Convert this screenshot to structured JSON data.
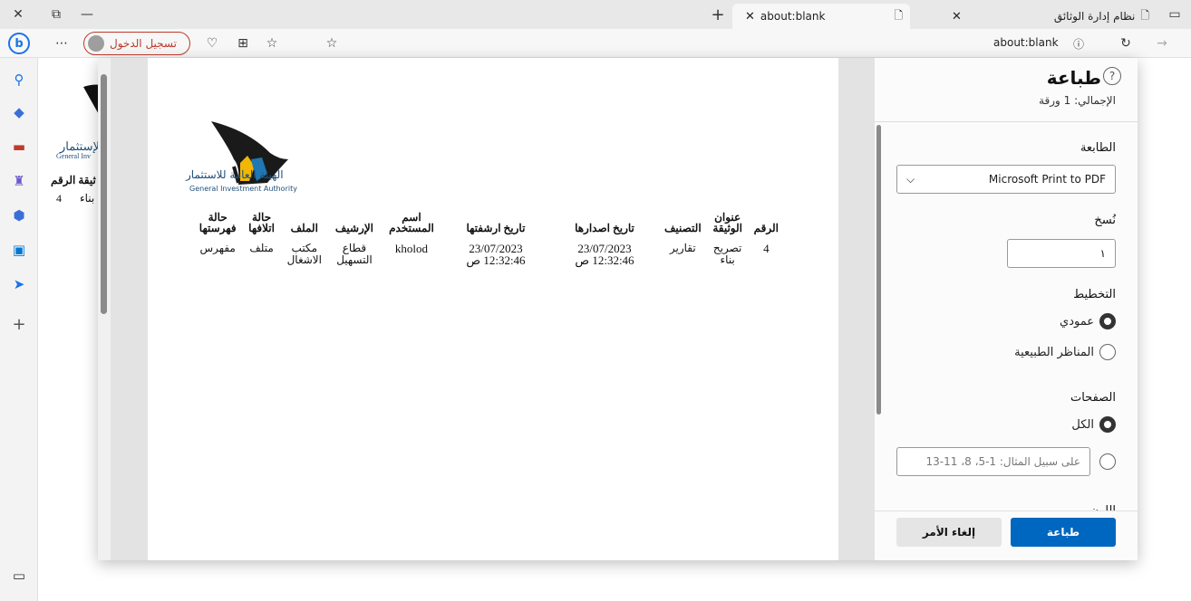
{
  "tabs": [
    {
      "title": "about:blank",
      "active": true
    },
    {
      "title": "نظام إدارة الوثائق",
      "active": false
    }
  ],
  "address": {
    "url": "about:blank",
    "signin_label": "تسجيل الدخول"
  },
  "bg_page": {
    "logo_text": "الإستثمار",
    "logo_en": "General Inv",
    "header": "ثيقة الرقم",
    "row_title": "بناء",
    "row_num": "4"
  },
  "print_panel": {
    "title": "طباعة",
    "total": "الإجمالي: 1 ورقة",
    "printer_label": "الطابعة",
    "printer_value": "Microsoft Print to PDF",
    "copies_label": "نُسخ",
    "copies_value": "١",
    "layout_label": "التخطيط",
    "layout_options": [
      "عمودي",
      "المناظر الطبيعية"
    ],
    "layout_selected": "عمودي",
    "pages_label": "الصفحات",
    "pages_all": "الكل",
    "pages_placeholder": "على سبيل المثال: 1-5، 8، 11-13",
    "color_label": "اللون",
    "print_button": "طباعة",
    "cancel_button": "إلغاء الأمر"
  },
  "document": {
    "logo_ar": "الهيئة العامة للاستثمار",
    "logo_en": "General Investment Authority",
    "columns": [
      "الرقم",
      "عنوان الوثيقة",
      "التصنيف",
      "تاريخ اصدارها",
      "تاريخ ارشفتها",
      "اسم المستخدم",
      "الإرشيف",
      "الملف",
      "حالة اتلافها",
      "حالة فهرستها"
    ],
    "rows": [
      {
        "number": "4",
        "title": "تصريح بناء",
        "category": "تقارير",
        "issue_date": "23/07/2023",
        "issue_time": "12:32:46 ص",
        "archive_date": "23/07/2023",
        "archive_time": "12:32:46 ص",
        "user": "kholod",
        "archive": "قطاع التسهيل",
        "file": "مكتب الاشغال",
        "destroy_status": "متلف",
        "index_status": "مفهرس"
      }
    ]
  }
}
